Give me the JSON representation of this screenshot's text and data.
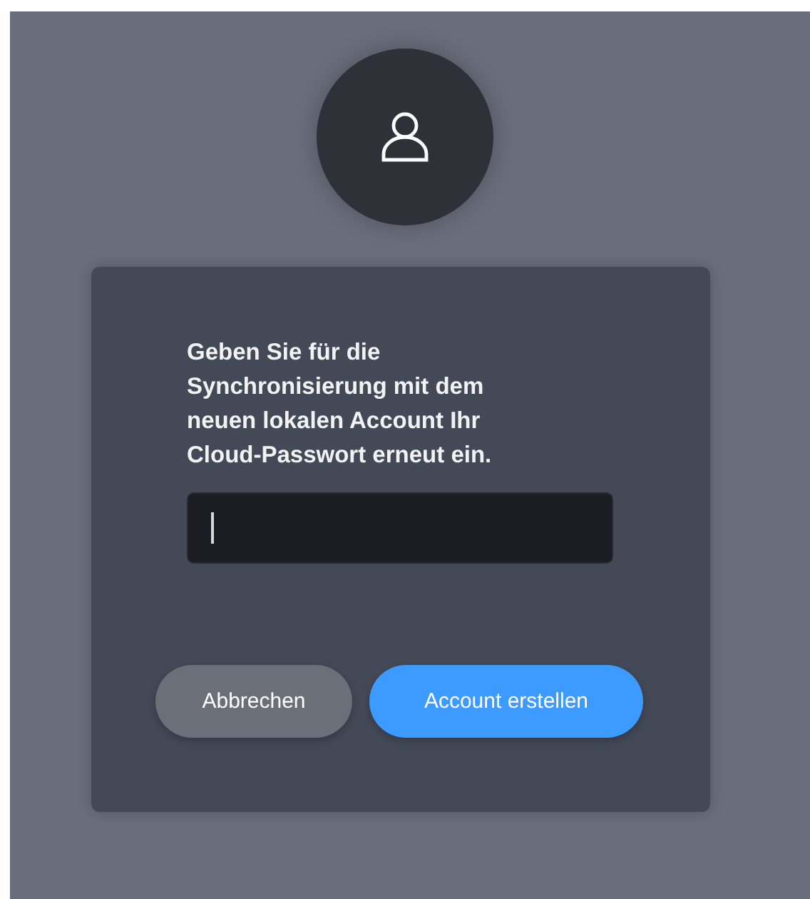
{
  "message": "Geben Sie für die Synchronisierung mit dem neuen lokalen Account Ihr Cloud-Passwort erneut ein.",
  "password_field": {
    "focused": true
  },
  "buttons": [
    {
      "label": "Abbrechen",
      "kind": "secondary"
    },
    {
      "label": "Account erstellen",
      "kind": "primary"
    }
  ]
}
